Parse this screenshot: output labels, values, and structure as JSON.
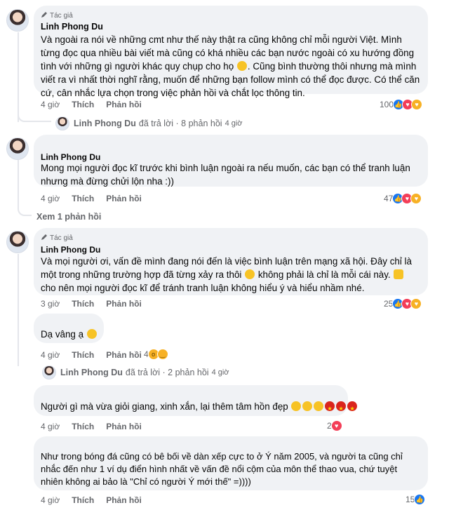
{
  "author_badge": "Tác giả",
  "comments": [
    {
      "author": "Linh Phong Du",
      "text": "Và ngoài ra nói về những cmt như thế này thật ra cũng không chỉ mỗi người Việt. Mình từng đọc qua nhiều bài viết mà cũng có khá nhiều các bạn nước ngoài có xu hướng đồng tình với những gì người khác quy chụp cho họ ",
      "text2": ". Cũng bình thường thôi nhưng mà mình viết ra vì nhất thời nghĩ rằng, muốn để những bạn follow mình có thể đọc được. Có thể căn cứ, cân nhắc lựa chọn trong việc phản hồi và chắt lọc thông tin.",
      "time": "4 giờ",
      "like": "Thích",
      "reply": "Phản hồi",
      "reactions": "100"
    },
    {
      "author": "Linh Phong Du",
      "text": "Mong mọi người đọc kĩ trước khi bình luận ngoài ra nếu muốn, các bạn có thể tranh luận nhưng mà đừng chửi lộn nha :))",
      "time": "4 giờ",
      "like": "Thích",
      "reply": "Phản hồi",
      "reactions": "47"
    },
    {
      "author": "Linh Phong Du",
      "text": "Và mọi người ơi, vấn đề mình đang nói đến là việc bình luận trên mạng xã hội. Đây chỉ là một trong những trường hợp đã từng xảy ra thôi ",
      "text2": " không phải là chỉ là mỗi cái này. ",
      "text3": " cho nên mọi người đọc kĩ để tránh tranh luận không hiểu ý và hiểu nhầm nhé.",
      "time": "3 giờ",
      "like": "Thích",
      "reply": "Phản hồi",
      "reactions": "25"
    }
  ],
  "thread1": {
    "name": "Linh Phong Du",
    "action": "đã trả lời · 8 phản hồi",
    "time": "4 giờ"
  },
  "see_more": "Xem 1 phản hồi",
  "reply_a": {
    "text": "Dạ vâng ạ",
    "time": "4 giờ",
    "like": "Thích",
    "reply": "Phản hồi",
    "reactions": "4"
  },
  "thread2": {
    "name": "Linh Phong Du",
    "action": "đã trả lời · 2 phản hồi",
    "time": "4 giờ"
  },
  "reply_b": {
    "text": "Người gì mà vừa giỏi giang, xinh xắn, lại thêm tâm hồn đẹp ",
    "time": "4 giờ",
    "like": "Thích",
    "reply": "Phản hồi",
    "reactions": "2"
  },
  "reply_c": {
    "text": "Như trong bóng đá cũng có bê bối về dàn xếp cực to ở Ý năm 2005, và người ta cũng chỉ nhắc đến như 1 ví dụ điển hình nhất về vấn đề nổi cộm của môn thể thao vua, chứ tuyệt nhiên không ai bảo là \"Chỉ có người Ý mới thế\" =))))",
    "time": "4 giờ",
    "like": "Thích",
    "reply": "Phản hồi",
    "reactions": "15"
  },
  "colors": {
    "bubble": "#f0f2f5",
    "muted": "#65676b",
    "like": "#1877f2",
    "love": "#f33e58",
    "care": "#f7b125"
  }
}
